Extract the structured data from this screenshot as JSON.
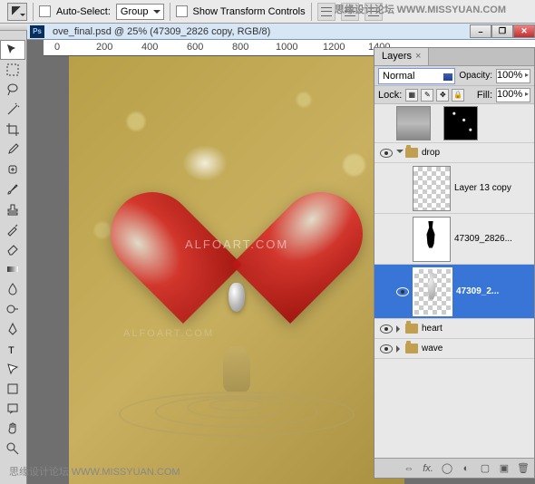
{
  "watermark_top_cn": "思缘设计论坛",
  "watermark_top_url": "WWW.MISSYUAN.COM",
  "options": {
    "auto_select": "Auto-Select:",
    "group": "Group",
    "show_transform": "Show Transform Controls"
  },
  "doc": {
    "title": "ove_final.psd @ 25% (47309_2826 copy, RGB/8)"
  },
  "ruler": {
    "m0": "0",
    "m200": "200",
    "m400": "400",
    "m600": "600",
    "m800": "800",
    "m1000": "1000",
    "m1200": "1200",
    "m1400": "1400"
  },
  "canvas_wm1": "ALFOART.COM",
  "canvas_wm2": "ALFOART.COM",
  "bottom_wm_cn": "思缘设计论坛",
  "bottom_wm_url": "WWW.MISSYUAN.COM",
  "layers": {
    "title": "Layers",
    "blend": "Normal",
    "opacity_label": "Opacity:",
    "opacity_val": "100%",
    "lock_label": "Lock:",
    "fill_label": "Fill:",
    "fill_val": "100%",
    "group_drop": "drop",
    "layer13": "Layer 13 copy",
    "layer_mask": "47309_2826...",
    "layer_sel": "47309_2...",
    "group_heart": "heart",
    "group_wave": "wave"
  },
  "footer": {
    "link": "⇔",
    "fx": "fx.",
    "mask": "◯",
    "adj": "◐",
    "folder": "▢",
    "new": "▣",
    "trash": "🗑"
  }
}
